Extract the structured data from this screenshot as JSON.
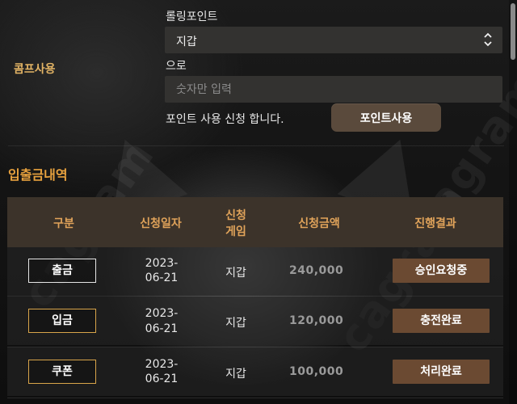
{
  "coupon_section": {
    "label": "콤프사용",
    "rolling_label": "롤링포인트",
    "select_value": "지갑",
    "to_label": "으로",
    "input_placeholder": "숫자만 입력",
    "apply_text": "포인트 사용 신청 합니다.",
    "use_button": "포인트사용"
  },
  "history": {
    "title": "입출금내역",
    "headers": {
      "type": "구분",
      "date": "신청일자",
      "game_line1": "신청",
      "game_line2": "게임",
      "amount": "신청금액",
      "result": "진행결과"
    },
    "rows": [
      {
        "type": "출금",
        "date_line1": "2023-",
        "date_line2": "06-21",
        "game": "지갑",
        "amount": "240,000",
        "status": "승인요청중"
      },
      {
        "type": "입금",
        "date_line1": "2023-",
        "date_line2": "06-21",
        "game": "지갑",
        "amount": "120,000",
        "status": "충전완료"
      },
      {
        "type": "쿠폰",
        "date_line1": "2023-",
        "date_line2": "06-21",
        "game": "지갑",
        "amount": "100,000",
        "status": "처리완료"
      }
    ]
  },
  "icons": {
    "select_arrows": "chevron-up-down-icon"
  },
  "colors": {
    "accent_gold": "#e8a23e",
    "header_bg": "#3c332a",
    "status_bg": "#6b4a32",
    "button_bg": "#5a4a3c"
  }
}
